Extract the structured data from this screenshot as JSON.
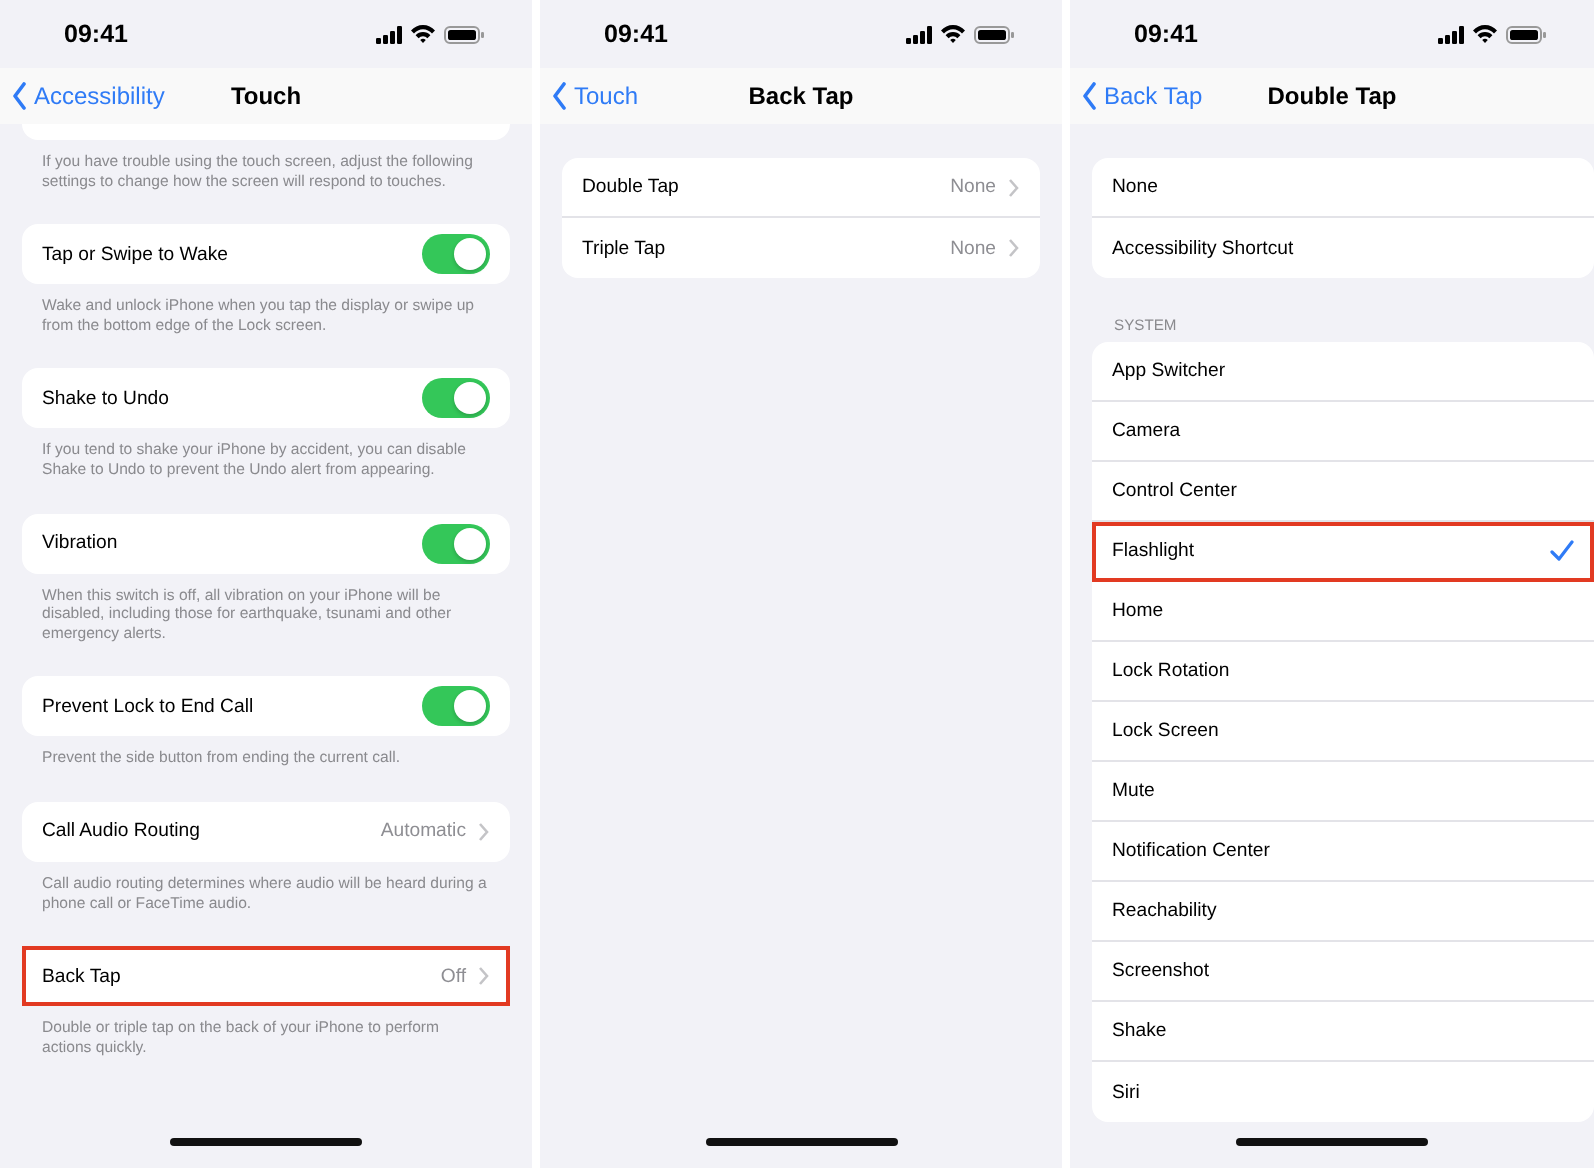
{
  "panels": [
    {
      "status_bar": {
        "time": "09:41"
      },
      "nav": {
        "back": "Accessibility",
        "title": "Touch"
      },
      "sections": [
        {
          "clipped_card": true,
          "footer": "If you have trouble using the touch screen, adjust the following settings to change how the screen will respond to touches."
        },
        {
          "rows": [
            {
              "kind": "toggle",
              "label": "Tap or Swipe to Wake",
              "on": true,
              "highlighted": false
            }
          ],
          "footer": "Wake and unlock iPhone when you tap the display or swipe up from the bottom edge of the Lock screen."
        },
        {
          "rows": [
            {
              "kind": "toggle",
              "label": "Shake to Undo",
              "on": true,
              "highlighted": false
            }
          ],
          "footer": "If you tend to shake your iPhone by accident, you can disable Shake to Undo to prevent the Undo alert from appearing."
        },
        {
          "rows": [
            {
              "kind": "toggle",
              "label": "Vibration",
              "on": true,
              "highlighted": false
            }
          ],
          "footer": "When this switch is off, all vibration on your iPhone will be disabled, including those for earthquake, tsunami and other emergency alerts."
        },
        {
          "rows": [
            {
              "kind": "toggle",
              "label": "Prevent Lock to End Call",
              "on": true,
              "highlighted": false
            }
          ],
          "footer": "Prevent the side button from ending the current call."
        },
        {
          "rows": [
            {
              "kind": "disclosure",
              "label": "Call Audio Routing",
              "value": "Automatic",
              "highlighted": false
            }
          ],
          "footer": "Call audio routing determines where audio will be heard during a phone call or FaceTime audio."
        },
        {
          "rows": [
            {
              "kind": "disclosure",
              "label": "Back Tap",
              "value": "Off",
              "highlighted": true
            }
          ],
          "footer": "Double or triple tap on the back of your iPhone to perform actions quickly."
        }
      ]
    },
    {
      "status_bar": {
        "time": "09:41"
      },
      "nav": {
        "back": "Touch",
        "title": "Back Tap"
      },
      "sections": [
        {
          "rows": [
            {
              "kind": "disclosure",
              "label": "Double Tap",
              "value": "None",
              "highlighted": false
            },
            {
              "kind": "disclosure",
              "label": "Triple Tap",
              "value": "None",
              "highlighted": false
            }
          ]
        }
      ]
    },
    {
      "status_bar": {
        "time": "09:41"
      },
      "nav": {
        "back": "Back Tap",
        "title": "Double Tap"
      },
      "sections": [
        {
          "rows": [
            {
              "kind": "choice",
              "label": "None",
              "selected": false,
              "highlighted": false
            },
            {
              "kind": "choice",
              "label": "Accessibility Shortcut",
              "selected": false,
              "highlighted": false
            }
          ]
        },
        {
          "header": "SYSTEM",
          "rows": [
            {
              "kind": "choice",
              "label": "App Switcher",
              "selected": false,
              "highlighted": false
            },
            {
              "kind": "choice",
              "label": "Camera",
              "selected": false,
              "highlighted": false
            },
            {
              "kind": "choice",
              "label": "Control Center",
              "selected": false,
              "highlighted": false
            },
            {
              "kind": "choice",
              "label": "Flashlight",
              "selected": true,
              "highlighted": true
            },
            {
              "kind": "choice",
              "label": "Home",
              "selected": false,
              "highlighted": false
            },
            {
              "kind": "choice",
              "label": "Lock Rotation",
              "selected": false,
              "highlighted": false
            },
            {
              "kind": "choice",
              "label": "Lock Screen",
              "selected": false,
              "highlighted": false
            },
            {
              "kind": "choice",
              "label": "Mute",
              "selected": false,
              "highlighted": false
            },
            {
              "kind": "choice",
              "label": "Notification Center",
              "selected": false,
              "highlighted": false
            },
            {
              "kind": "choice",
              "label": "Reachability",
              "selected": false,
              "highlighted": false
            },
            {
              "kind": "choice",
              "label": "Screenshot",
              "selected": false,
              "highlighted": false
            },
            {
              "kind": "choice",
              "label": "Shake",
              "selected": false,
              "highlighted": false
            },
            {
              "kind": "choice",
              "label": "Siri",
              "selected": false,
              "highlighted": false
            }
          ]
        }
      ]
    }
  ]
}
